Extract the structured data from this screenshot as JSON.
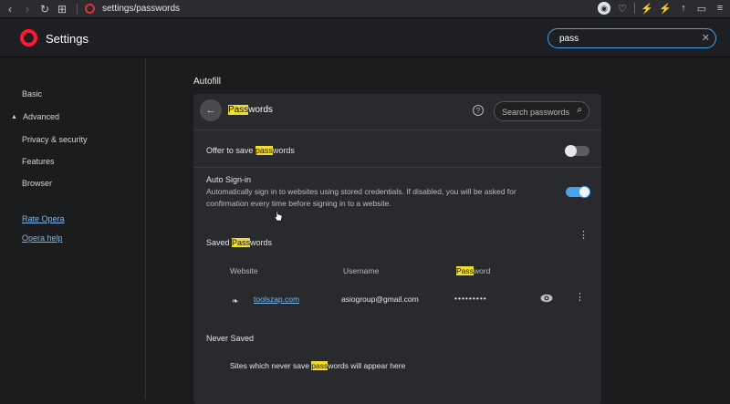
{
  "browser": {
    "url": "settings/passwords"
  },
  "header": {
    "title": "Settings",
    "search_value": "pass"
  },
  "sidebar": {
    "basic": "Basic",
    "advanced": "Advanced",
    "items": [
      "Privacy & security",
      "Features",
      "Browser"
    ],
    "links": [
      "Rate Opera",
      "Opera help"
    ]
  },
  "main": {
    "section_title": "Autofill",
    "card": {
      "title_highlight": "Pass",
      "title_rest": "words",
      "search_placeholder": "Search passwords",
      "offer_save": {
        "prefix": "Offer to save ",
        "highlight": "pass",
        "suffix": "words",
        "enabled": false
      },
      "auto_signin": {
        "label": "Auto Sign-in",
        "description": "Automatically sign in to websites using stored credentials. If disabled, you will be asked for confirmation every time before signing in to a website.",
        "enabled": true
      },
      "saved": {
        "prefix": "Saved ",
        "highlight": "Pass",
        "suffix": "words",
        "columns": {
          "website": "Website",
          "username": "Username",
          "password_highlight": "Pass",
          "password_rest": "word"
        },
        "entries": [
          {
            "website": "toolszap.com",
            "username": "asiogroup@gmail.com",
            "password": "•••••••••"
          }
        ]
      },
      "never_saved": {
        "title": "Never Saved",
        "prefix": "Sites which never save ",
        "highlight": "pass",
        "suffix": "words will appear here"
      }
    }
  },
  "colors": {
    "accent": "#4aa3e8",
    "highlight": "#f1dd2d",
    "opera_red": "#ff1b2d"
  }
}
